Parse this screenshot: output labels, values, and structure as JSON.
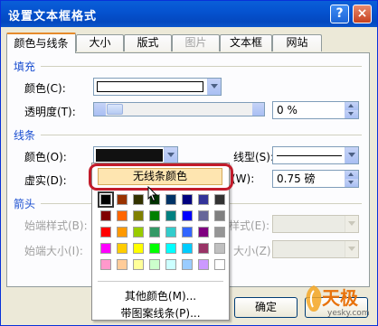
{
  "window": {
    "title": "设置文本框格式",
    "help_label": "?",
    "close_label": "×"
  },
  "tabs": [
    {
      "label": "颜色与线条",
      "active": true,
      "disabled": false
    },
    {
      "label": "大小",
      "active": false,
      "disabled": false
    },
    {
      "label": "版式",
      "active": false,
      "disabled": false
    },
    {
      "label": "图片",
      "active": false,
      "disabled": true
    },
    {
      "label": "文本框",
      "active": false,
      "disabled": false
    },
    {
      "label": "网站",
      "active": false,
      "disabled": false
    }
  ],
  "fill": {
    "section_label": "填充",
    "color_label": "颜色(C):",
    "color_value": "#ffffff",
    "transparency_label": "透明度(T):",
    "transparency_value": "0 %"
  },
  "line": {
    "section_label": "线条",
    "color_label": "颜色(O):",
    "color_value": "#111111",
    "style_label": "线型(S):",
    "dash_label": "虚实(D):",
    "weight_label": "(W):",
    "weight_value": "0.75 磅"
  },
  "arrows": {
    "section_label": "箭头",
    "begin_style_label": "始端样式(B):",
    "begin_size_label": "始端大小(I):",
    "end_style_label": "样式(E):",
    "end_size_label": "大小(Z):"
  },
  "color_popup": {
    "no_line_label": "无线条颜色",
    "more_colors_label": "其他颜色(M)...",
    "pattern_lines_label": "带图案线条(P)...",
    "palette": [
      [
        "#000000",
        "#993300",
        "#333300",
        "#003300",
        "#003366",
        "#000080",
        "#333399",
        "#333333"
      ],
      [
        "#800000",
        "#ff6600",
        "#808000",
        "#008000",
        "#008080",
        "#0000ff",
        "#666699",
        "#808080"
      ],
      [
        "#ff0000",
        "#ff9900",
        "#99cc00",
        "#339966",
        "#33cccc",
        "#3366ff",
        "#800080",
        "#969696"
      ],
      [
        "#ff00ff",
        "#ffcc00",
        "#ffff00",
        "#00ff00",
        "#00ffff",
        "#00ccff",
        "#993366",
        "#c0c0c0"
      ],
      [
        "#ff99cc",
        "#ffcc99",
        "#ffff99",
        "#ccffcc",
        "#ccffff",
        "#99ccff",
        "#cc99ff",
        "#ffffff"
      ]
    ]
  },
  "footer": {
    "ok_label": "确定"
  },
  "watermark": {
    "brand": "天极",
    "site": "yesky.com"
  },
  "colors": {
    "highlight": "#c21b2a",
    "section_text": "#1a4ed0"
  }
}
